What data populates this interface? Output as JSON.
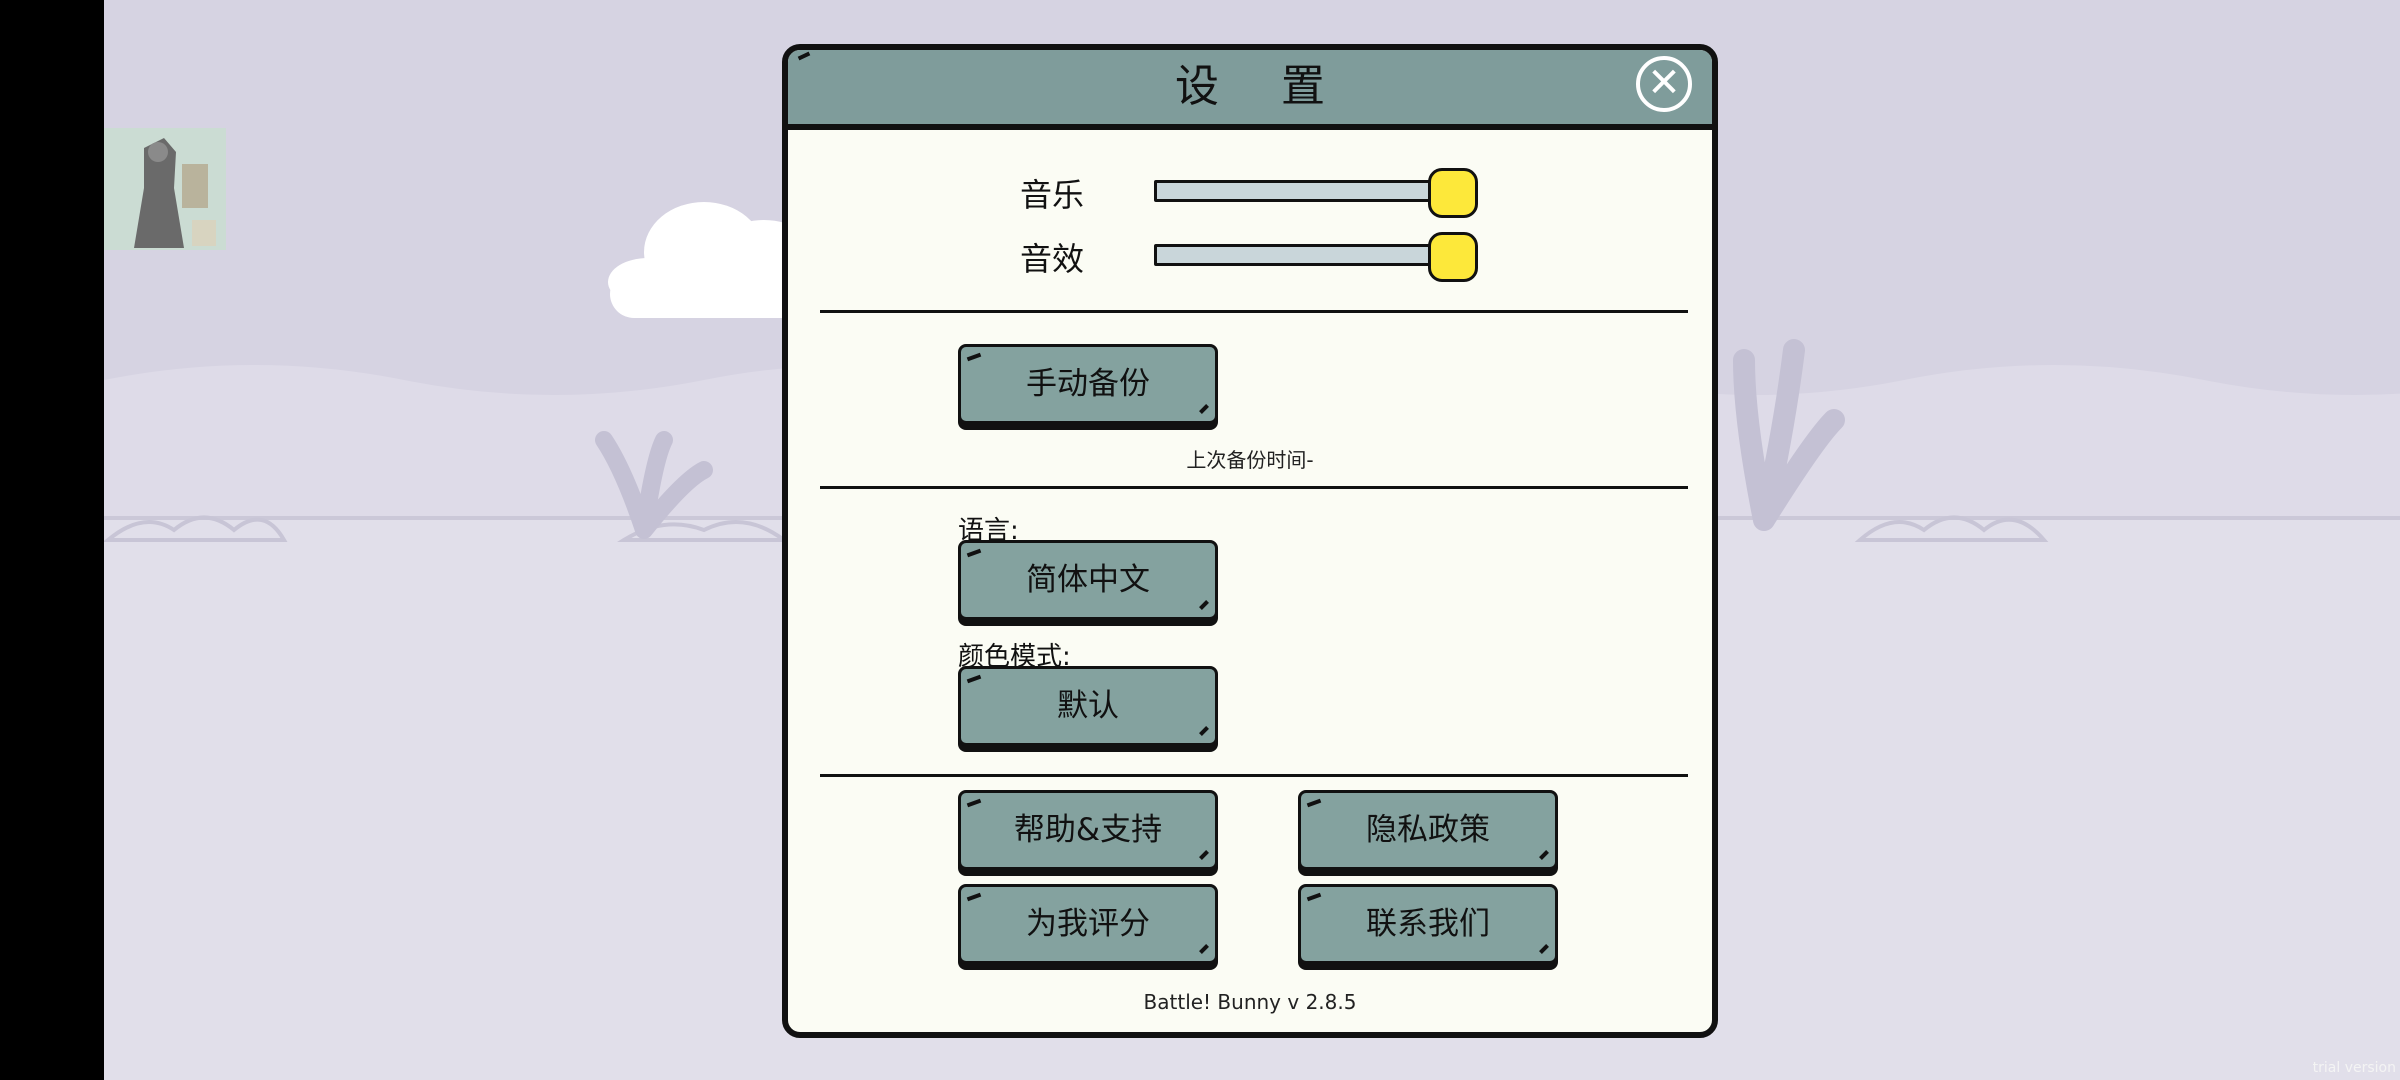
{
  "dialog": {
    "title": "设 置"
  },
  "audio": {
    "music": {
      "label": "音乐",
      "level": 1.0
    },
    "sfx": {
      "label": "音效",
      "level": 1.0
    }
  },
  "backup": {
    "manual_button": "手动备份",
    "last_backup_text": "上次备份时间-"
  },
  "language": {
    "label": "语言:",
    "value": "简体中文"
  },
  "color_mode": {
    "label": "颜色模式:",
    "value": "默认"
  },
  "links": {
    "help": "帮助&支持",
    "privacy": "隐私政策",
    "rate": "为我评分",
    "contact": "联系我们"
  },
  "version": "Battle! Bunny v 2.8.5",
  "watermark": "trial version",
  "colors": {
    "panel_bg": "#fbfcf4",
    "header_bg": "#7f9c9b",
    "button_bg": "#84a29f",
    "slider_knob": "#fde83a",
    "scene_bg": "#d6d3e2"
  },
  "icons": {
    "close": "close-circle-icon"
  }
}
